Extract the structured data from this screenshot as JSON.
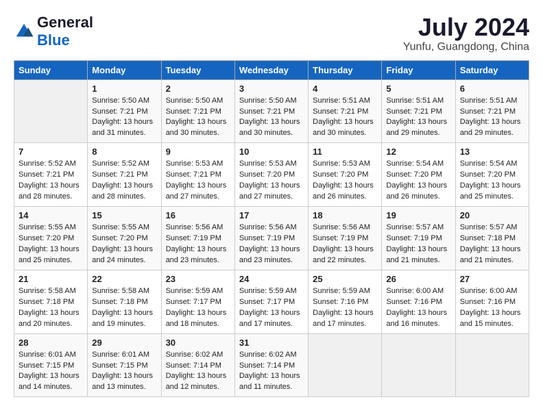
{
  "header": {
    "logo": {
      "general": "General",
      "blue": "Blue"
    },
    "title": "July 2024",
    "location": "Yunfu, Guangdong, China"
  },
  "calendar": {
    "days_of_week": [
      "Sunday",
      "Monday",
      "Tuesday",
      "Wednesday",
      "Thursday",
      "Friday",
      "Saturday"
    ],
    "weeks": [
      [
        {
          "day": "",
          "content": ""
        },
        {
          "day": "1",
          "content": "Sunrise: 5:50 AM\nSunset: 7:21 PM\nDaylight: 13 hours\nand 31 minutes."
        },
        {
          "day": "2",
          "content": "Sunrise: 5:50 AM\nSunset: 7:21 PM\nDaylight: 13 hours\nand 30 minutes."
        },
        {
          "day": "3",
          "content": "Sunrise: 5:50 AM\nSunset: 7:21 PM\nDaylight: 13 hours\nand 30 minutes."
        },
        {
          "day": "4",
          "content": "Sunrise: 5:51 AM\nSunset: 7:21 PM\nDaylight: 13 hours\nand 30 minutes."
        },
        {
          "day": "5",
          "content": "Sunrise: 5:51 AM\nSunset: 7:21 PM\nDaylight: 13 hours\nand 29 minutes."
        },
        {
          "day": "6",
          "content": "Sunrise: 5:51 AM\nSunset: 7:21 PM\nDaylight: 13 hours\nand 29 minutes."
        }
      ],
      [
        {
          "day": "7",
          "content": "Sunrise: 5:52 AM\nSunset: 7:21 PM\nDaylight: 13 hours\nand 28 minutes."
        },
        {
          "day": "8",
          "content": "Sunrise: 5:52 AM\nSunset: 7:21 PM\nDaylight: 13 hours\nand 28 minutes."
        },
        {
          "day": "9",
          "content": "Sunrise: 5:53 AM\nSunset: 7:21 PM\nDaylight: 13 hours\nand 27 minutes."
        },
        {
          "day": "10",
          "content": "Sunrise: 5:53 AM\nSunset: 7:20 PM\nDaylight: 13 hours\nand 27 minutes."
        },
        {
          "day": "11",
          "content": "Sunrise: 5:53 AM\nSunset: 7:20 PM\nDaylight: 13 hours\nand 26 minutes."
        },
        {
          "day": "12",
          "content": "Sunrise: 5:54 AM\nSunset: 7:20 PM\nDaylight: 13 hours\nand 26 minutes."
        },
        {
          "day": "13",
          "content": "Sunrise: 5:54 AM\nSunset: 7:20 PM\nDaylight: 13 hours\nand 25 minutes."
        }
      ],
      [
        {
          "day": "14",
          "content": "Sunrise: 5:55 AM\nSunset: 7:20 PM\nDaylight: 13 hours\nand 25 minutes."
        },
        {
          "day": "15",
          "content": "Sunrise: 5:55 AM\nSunset: 7:20 PM\nDaylight: 13 hours\nand 24 minutes."
        },
        {
          "day": "16",
          "content": "Sunrise: 5:56 AM\nSunset: 7:19 PM\nDaylight: 13 hours\nand 23 minutes."
        },
        {
          "day": "17",
          "content": "Sunrise: 5:56 AM\nSunset: 7:19 PM\nDaylight: 13 hours\nand 23 minutes."
        },
        {
          "day": "18",
          "content": "Sunrise: 5:56 AM\nSunset: 7:19 PM\nDaylight: 13 hours\nand 22 minutes."
        },
        {
          "day": "19",
          "content": "Sunrise: 5:57 AM\nSunset: 7:19 PM\nDaylight: 13 hours\nand 21 minutes."
        },
        {
          "day": "20",
          "content": "Sunrise: 5:57 AM\nSunset: 7:18 PM\nDaylight: 13 hours\nand 21 minutes."
        }
      ],
      [
        {
          "day": "21",
          "content": "Sunrise: 5:58 AM\nSunset: 7:18 PM\nDaylight: 13 hours\nand 20 minutes."
        },
        {
          "day": "22",
          "content": "Sunrise: 5:58 AM\nSunset: 7:18 PM\nDaylight: 13 hours\nand 19 minutes."
        },
        {
          "day": "23",
          "content": "Sunrise: 5:59 AM\nSunset: 7:17 PM\nDaylight: 13 hours\nand 18 minutes."
        },
        {
          "day": "24",
          "content": "Sunrise: 5:59 AM\nSunset: 7:17 PM\nDaylight: 13 hours\nand 17 minutes."
        },
        {
          "day": "25",
          "content": "Sunrise: 5:59 AM\nSunset: 7:16 PM\nDaylight: 13 hours\nand 17 minutes."
        },
        {
          "day": "26",
          "content": "Sunrise: 6:00 AM\nSunset: 7:16 PM\nDaylight: 13 hours\nand 16 minutes."
        },
        {
          "day": "27",
          "content": "Sunrise: 6:00 AM\nSunset: 7:16 PM\nDaylight: 13 hours\nand 15 minutes."
        }
      ],
      [
        {
          "day": "28",
          "content": "Sunrise: 6:01 AM\nSunset: 7:15 PM\nDaylight: 13 hours\nand 14 minutes."
        },
        {
          "day": "29",
          "content": "Sunrise: 6:01 AM\nSunset: 7:15 PM\nDaylight: 13 hours\nand 13 minutes."
        },
        {
          "day": "30",
          "content": "Sunrise: 6:02 AM\nSunset: 7:14 PM\nDaylight: 13 hours\nand 12 minutes."
        },
        {
          "day": "31",
          "content": "Sunrise: 6:02 AM\nSunset: 7:14 PM\nDaylight: 13 hours\nand 11 minutes."
        },
        {
          "day": "",
          "content": ""
        },
        {
          "day": "",
          "content": ""
        },
        {
          "day": "",
          "content": ""
        }
      ]
    ]
  }
}
